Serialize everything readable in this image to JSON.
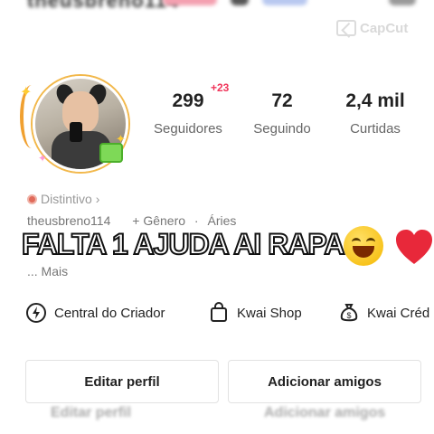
{
  "header": {
    "blurred_username": "theusbreno114"
  },
  "watermark": {
    "label": "CapCut"
  },
  "profile": {
    "stats": [
      {
        "value": "299",
        "label": "Seguidores",
        "badge": "+23"
      },
      {
        "value": "72",
        "label": "Seguindo"
      },
      {
        "value": "2,4 mil",
        "label": "Curtidas"
      }
    ],
    "distintivo": "Distintivo",
    "username": "theusbreno114",
    "gender_button": "+ Gênero",
    "sign": "Áries",
    "more": "... Mais"
  },
  "overlay_text": "FALTA 1 AJUDA AI RAPA",
  "actions": [
    {
      "label": "Central do Criador",
      "icon": "lightning-icon"
    },
    {
      "label": "Kwai Shop",
      "icon": "shopping-bag-icon"
    },
    {
      "label": "Kwai Créd",
      "icon": "money-bag-icon"
    }
  ],
  "buttons": {
    "edit_profile": "Editar perfil",
    "add_friends": "Adicionar amigos"
  },
  "colors": {
    "badge": "#f0355a",
    "heart": "#e8283a",
    "smile": "#f5b800"
  }
}
